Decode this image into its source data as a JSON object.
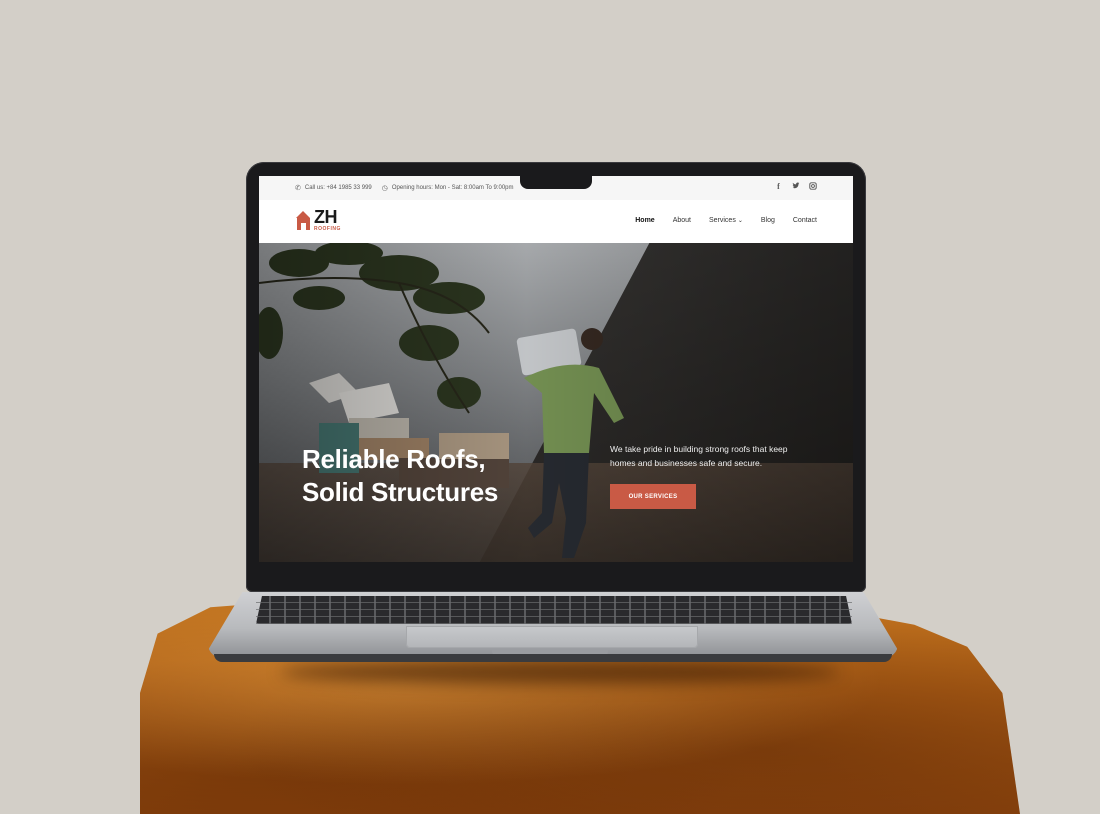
{
  "topbar": {
    "phone": "Call us: +84 1985 33 999",
    "hours": "Opening hours: Mon - Sat: 8:00am To 9:00pm",
    "socials": [
      "facebook-icon",
      "twitter-icon",
      "instagram-icon"
    ]
  },
  "brand": {
    "name": "ZH",
    "tagline": "ROOFING",
    "accent": "#c95a45"
  },
  "nav": {
    "items": [
      {
        "label": "Home",
        "active": true
      },
      {
        "label": "About"
      },
      {
        "label": "Services",
        "dropdown": true
      },
      {
        "label": "Blog"
      },
      {
        "label": "Contact"
      }
    ]
  },
  "hero": {
    "headline_1": "Reliable Roofs,",
    "headline_2": "Solid Structures",
    "subtext": "We take pride in building strong roofs that keep homes and businesses safe and secure.",
    "cta_label": "OUR SERVICES"
  }
}
